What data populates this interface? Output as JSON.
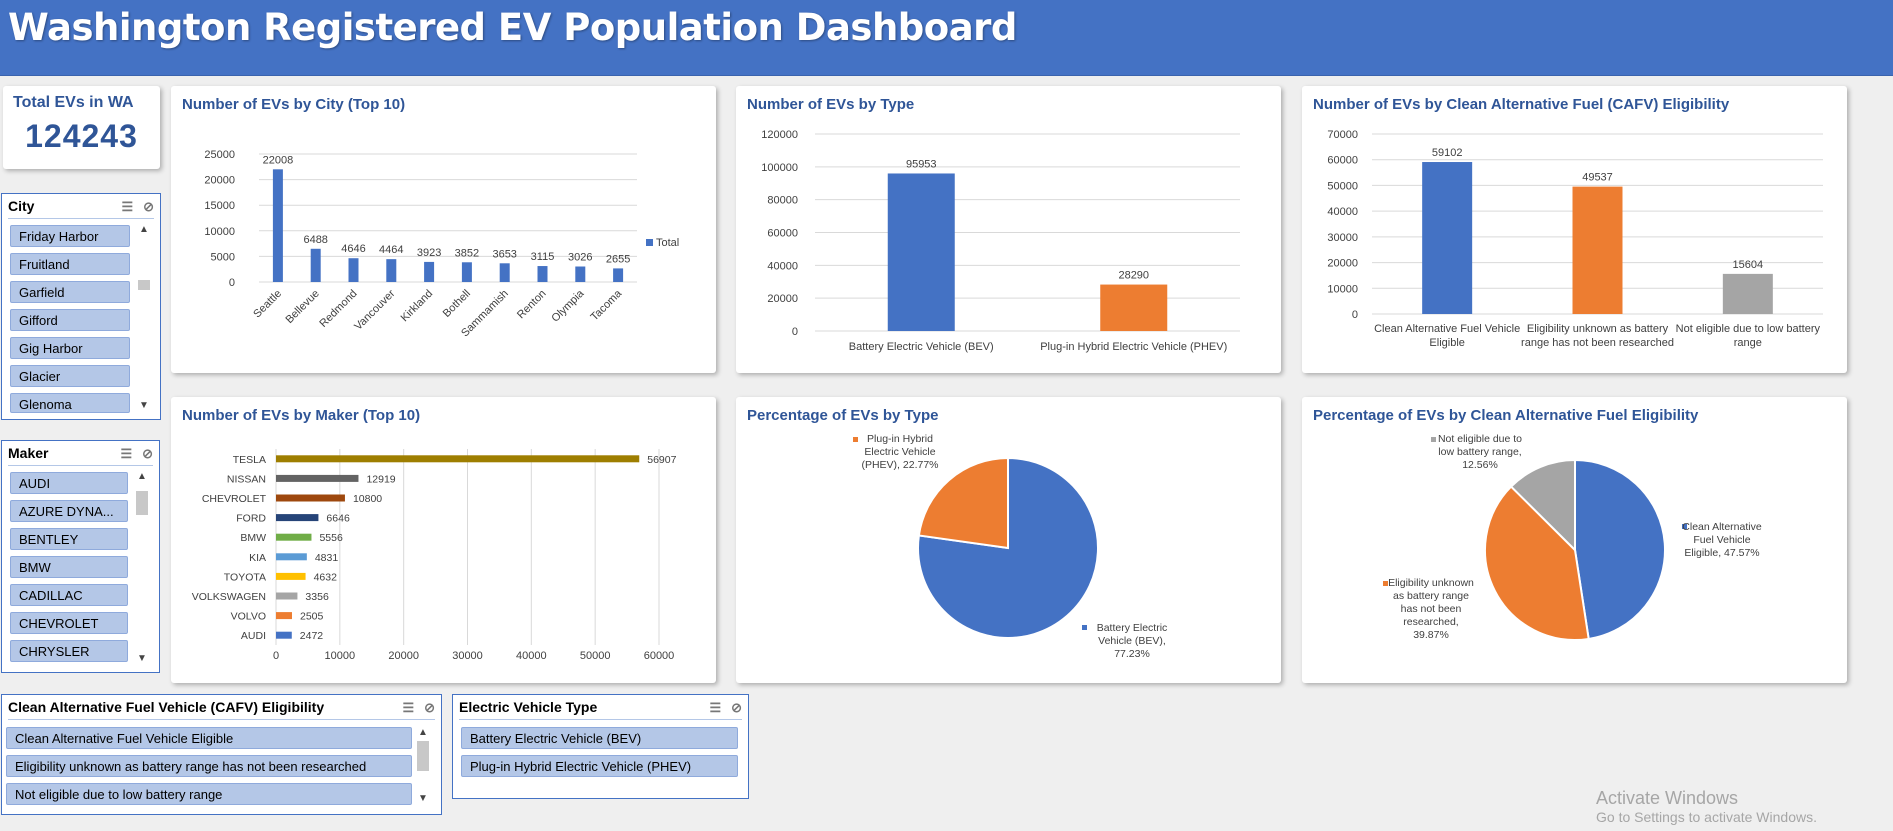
{
  "header": {
    "title": "Washington Registered EV Population Dashboard"
  },
  "kpi": {
    "label": "Total EVs in WA",
    "value": "124243"
  },
  "slicers": {
    "city": {
      "title": "City",
      "items": [
        "Friday Harbor",
        "Fruitland",
        "Garfield",
        "Gifford",
        "Gig Harbor",
        "Glacier",
        "Glenoma"
      ]
    },
    "maker": {
      "title": "Maker",
      "items": [
        "AUDI",
        "AZURE DYNA...",
        "BENTLEY",
        "BMW",
        "CADILLAC",
        "CHEVROLET",
        "CHRYSLER"
      ]
    },
    "cafv": {
      "title": "Clean Alternative Fuel Vehicle (CAFV) Eligibility",
      "items": [
        "Clean Alternative Fuel Vehicle Eligible",
        "Eligibility unknown as battery range has not been researched",
        "Not eligible due to low battery range"
      ]
    },
    "ev_type": {
      "title": "Electric Vehicle Type",
      "items": [
        "Battery Electric Vehicle (BEV)",
        "Plug-in Hybrid Electric Vehicle (PHEV)"
      ]
    }
  },
  "icons": {
    "multi_select": "multi-select-icon",
    "clear_filter": "clear-filter-icon",
    "scroll_up": "▲",
    "scroll_down": "▼"
  },
  "colors": {
    "header": "#4472c4",
    "bev": "#4472c4",
    "phev": "#ed7d31",
    "not_eligible": "#a5a5a5",
    "title": "#2f5597"
  },
  "chart_data": [
    {
      "id": "city",
      "type": "bar",
      "title": "Number of EVs by City (Top 10)",
      "categories": [
        "Seattle",
        "Bellevue",
        "Redmond",
        "Vancouver",
        "Kirkland",
        "Bothell",
        "Sammamish",
        "Renton",
        "Olympia",
        "Tacoma"
      ],
      "series": [
        {
          "name": "Total",
          "values": [
            22008,
            6488,
            4646,
            4464,
            3923,
            3852,
            3653,
            3115,
            3026,
            2655
          ],
          "color": "#4472c4"
        }
      ],
      "ylim": [
        0,
        25000
      ],
      "yticks": [
        0,
        5000,
        10000,
        15000,
        20000,
        25000
      ],
      "legend": "right",
      "grid": true
    },
    {
      "id": "type",
      "type": "bar",
      "title": "Number of EVs by Type",
      "categories": [
        "Battery Electric Vehicle (BEV)",
        "Plug-in Hybrid Electric Vehicle (PHEV)"
      ],
      "values": [
        95953,
        28290
      ],
      "colors": [
        "#4472c4",
        "#ed7d31"
      ],
      "ylim": [
        0,
        120000
      ],
      "yticks": [
        0,
        20000,
        40000,
        60000,
        80000,
        100000,
        120000
      ],
      "grid": true
    },
    {
      "id": "cafv",
      "type": "bar",
      "title": "Number of EVs by Clean Alternative Fuel (CAFV) Eligibility",
      "categories": [
        [
          "Clean Alternative Fuel Vehicle",
          "Eligible"
        ],
        [
          "Eligibility unknown as battery",
          "range has not been researched"
        ],
        [
          "Not eligible due to low battery",
          "range"
        ]
      ],
      "values": [
        59102,
        49537,
        15604
      ],
      "colors": [
        "#4472c4",
        "#ed7d31",
        "#a5a5a5"
      ],
      "ylim": [
        0,
        70000
      ],
      "yticks": [
        0,
        10000,
        20000,
        30000,
        40000,
        50000,
        60000,
        70000
      ],
      "grid": true
    },
    {
      "id": "maker",
      "type": "bar",
      "orientation": "horizontal",
      "title": "Number of EVs by Maker (Top 10)",
      "categories": [
        "TESLA",
        "NISSAN",
        "CHEVROLET",
        "FORD",
        "BMW",
        "KIA",
        "TOYOTA",
        "VOLKSWAGEN",
        "VOLVO",
        "AUDI"
      ],
      "values": [
        56907,
        12919,
        10800,
        6646,
        5556,
        4831,
        4632,
        3356,
        2505,
        2472
      ],
      "colors": [
        "#9e7e00",
        "#636363",
        "#9e480e",
        "#264478",
        "#70ad47",
        "#5b9bd5",
        "#ffc000",
        "#a5a5a5",
        "#ed7d31",
        "#4472c4"
      ],
      "xlim": [
        0,
        60000
      ],
      "xticks": [
        0,
        10000,
        20000,
        30000,
        40000,
        50000,
        60000
      ],
      "grid": true
    },
    {
      "id": "pie_type",
      "type": "pie",
      "title": "Percentage of EVs by Type",
      "slices": [
        {
          "label": [
            "Battery Electric",
            "Vehicle (BEV),",
            "77.23%"
          ],
          "value": 77.23,
          "color": "#4472c4"
        },
        {
          "label": [
            "Plug-in Hybrid",
            "Electric Vehicle",
            "(PHEV), 22.77%"
          ],
          "value": 22.77,
          "color": "#ed7d31"
        }
      ]
    },
    {
      "id": "pie_cafv",
      "type": "pie",
      "title": "Percentage of EVs by Clean Alternative Fuel Eligibility",
      "slices": [
        {
          "label": [
            "Clean Alternative",
            "Fuel Vehicle",
            "Eligible, 47.57%"
          ],
          "value": 47.57,
          "color": "#4472c4"
        },
        {
          "label": [
            "Eligibility unknown",
            "as battery range",
            "has not been",
            "researched,",
            "39.87%"
          ],
          "value": 39.87,
          "color": "#ed7d31"
        },
        {
          "label": [
            "Not eligible due to",
            "low battery range,",
            "12.56%"
          ],
          "value": 12.56,
          "color": "#a5a5a5"
        }
      ]
    }
  ],
  "watermark": {
    "line1": "Activate Windows",
    "line2": "Go to Settings to activate Windows."
  }
}
